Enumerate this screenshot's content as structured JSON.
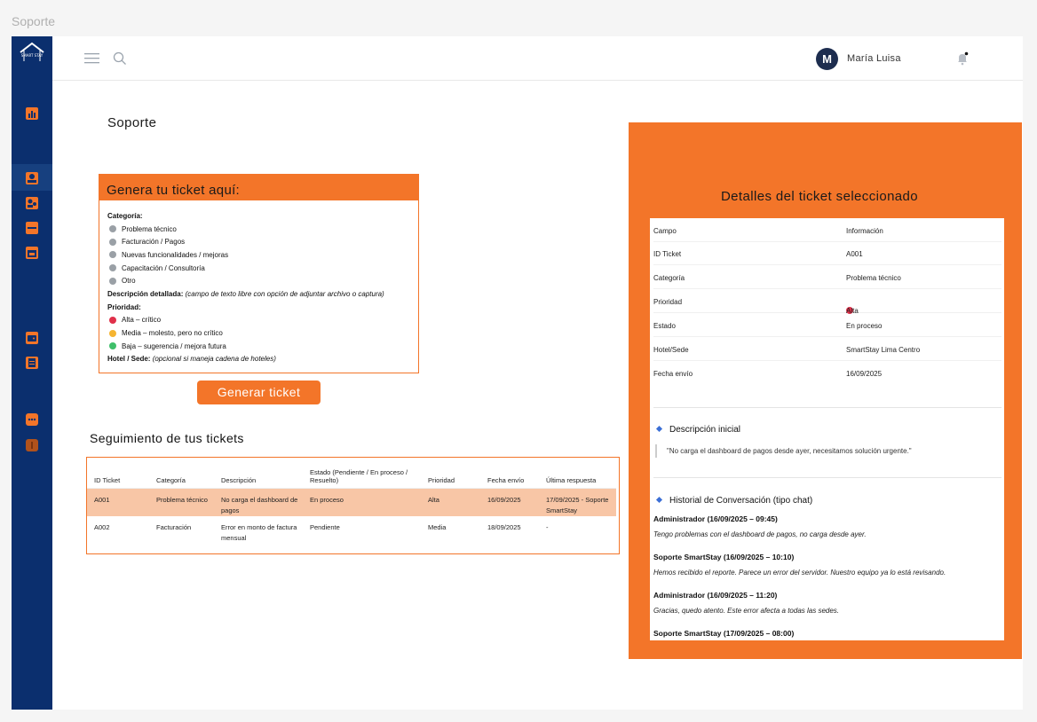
{
  "window": {
    "title": "Soporte"
  },
  "sidebar": {
    "logo_text": "SMART STAY",
    "icons": [
      "dashboard-icon",
      "user-profile-icon",
      "users-icon",
      "bed-icon",
      "calendar-icon",
      "wallet-icon",
      "document-icon",
      "chat-icon",
      "info-icon"
    ]
  },
  "header": {
    "avatar_initial": "M",
    "user_name": "María Luisa"
  },
  "page": {
    "title": "Soporte"
  },
  "form": {
    "title": "Genera tu ticket aquí:",
    "category_label": "Categoría:",
    "categories": [
      "Problema técnico",
      "Facturación / Pagos",
      "Nuevas funcionalidades / mejoras",
      "Capacitación / Consultoría",
      "Otro"
    ],
    "description_label": "Descripción detallada:",
    "description_hint": "(campo de texto libre con opción de adjuntar archivo o captura)",
    "priority_label": "Prioridad:",
    "priorities": [
      {
        "label": "Alta – crítico",
        "color": "#e0304a"
      },
      {
        "label": "Media – molesto, pero no crítico",
        "color": "#f5b431"
      },
      {
        "label": "Baja – sugerencia / mejora futura",
        "color": "#3fbf6a"
      }
    ],
    "hotel_label": "Hotel / Sede:",
    "hotel_hint": "(opcional si maneja cadena de hoteles)",
    "submit_label": "Generar ticket"
  },
  "tracking": {
    "title": "Seguimiento de tus tickets",
    "columns": [
      "ID Ticket",
      "Categoría",
      "Descripción",
      "Estado (Pendiente / En proceso / Resuelto)",
      "Prioridad",
      "Fecha envío",
      "Última respuesta"
    ],
    "rows": [
      [
        "A001",
        "Problema técnico",
        "No carga el dashboard de pagos",
        "En proceso",
        "Alta",
        "16/09/2025",
        "17/09/2025 - Soporte SmartStay"
      ],
      [
        "A002",
        "Facturación",
        "Error en monto de factura mensual",
        "Pendiente",
        "Media",
        "18/09/2025",
        "-"
      ]
    ]
  },
  "details": {
    "title": "Detalles del ticket seleccionado",
    "header": {
      "field": "Campo",
      "info": "Información"
    },
    "fields": [
      {
        "field": "ID Ticket",
        "value": "A001"
      },
      {
        "field": "Categoría",
        "value": "Problema técnico"
      },
      {
        "field": "Prioridad",
        "value": "Alta"
      },
      {
        "field": "Estado",
        "value": "En proceso"
      },
      {
        "field": "Hotel/Sede",
        "value": "SmartStay Lima Centro"
      },
      {
        "field": "Fecha envío",
        "value": "16/09/2025"
      }
    ],
    "description_title": "Descripción inicial",
    "description_text": "\"No carga el dashboard de pagos desde ayer, necesitamos solución urgente.\"",
    "history_title": "Historial de Conversación (tipo chat)",
    "messages": [
      {
        "author": "Administrador (16/09/2025 – 09:45)",
        "text": "Tengo problemas con el dashboard de pagos, no carga desde ayer."
      },
      {
        "author": "Soporte SmartStay (16/09/2025 – 10:10)",
        "text": "Hemos recibido el reporte. Parece un error del servidor. Nuestro equipo ya lo está revisando."
      },
      {
        "author": "Administrador (16/09/2025 – 11:20)",
        "text": "Gracias, quedo atento. Este error afecta a todas las sedes."
      },
      {
        "author": "Soporte SmartStay (17/09/2025 – 08:00)",
        "text": ""
      }
    ]
  },
  "colors": {
    "accent": "#f37529",
    "sidebar": "#0b2f6e",
    "selected_row": "#f8c6a6",
    "priority_high": "#e0304a"
  }
}
